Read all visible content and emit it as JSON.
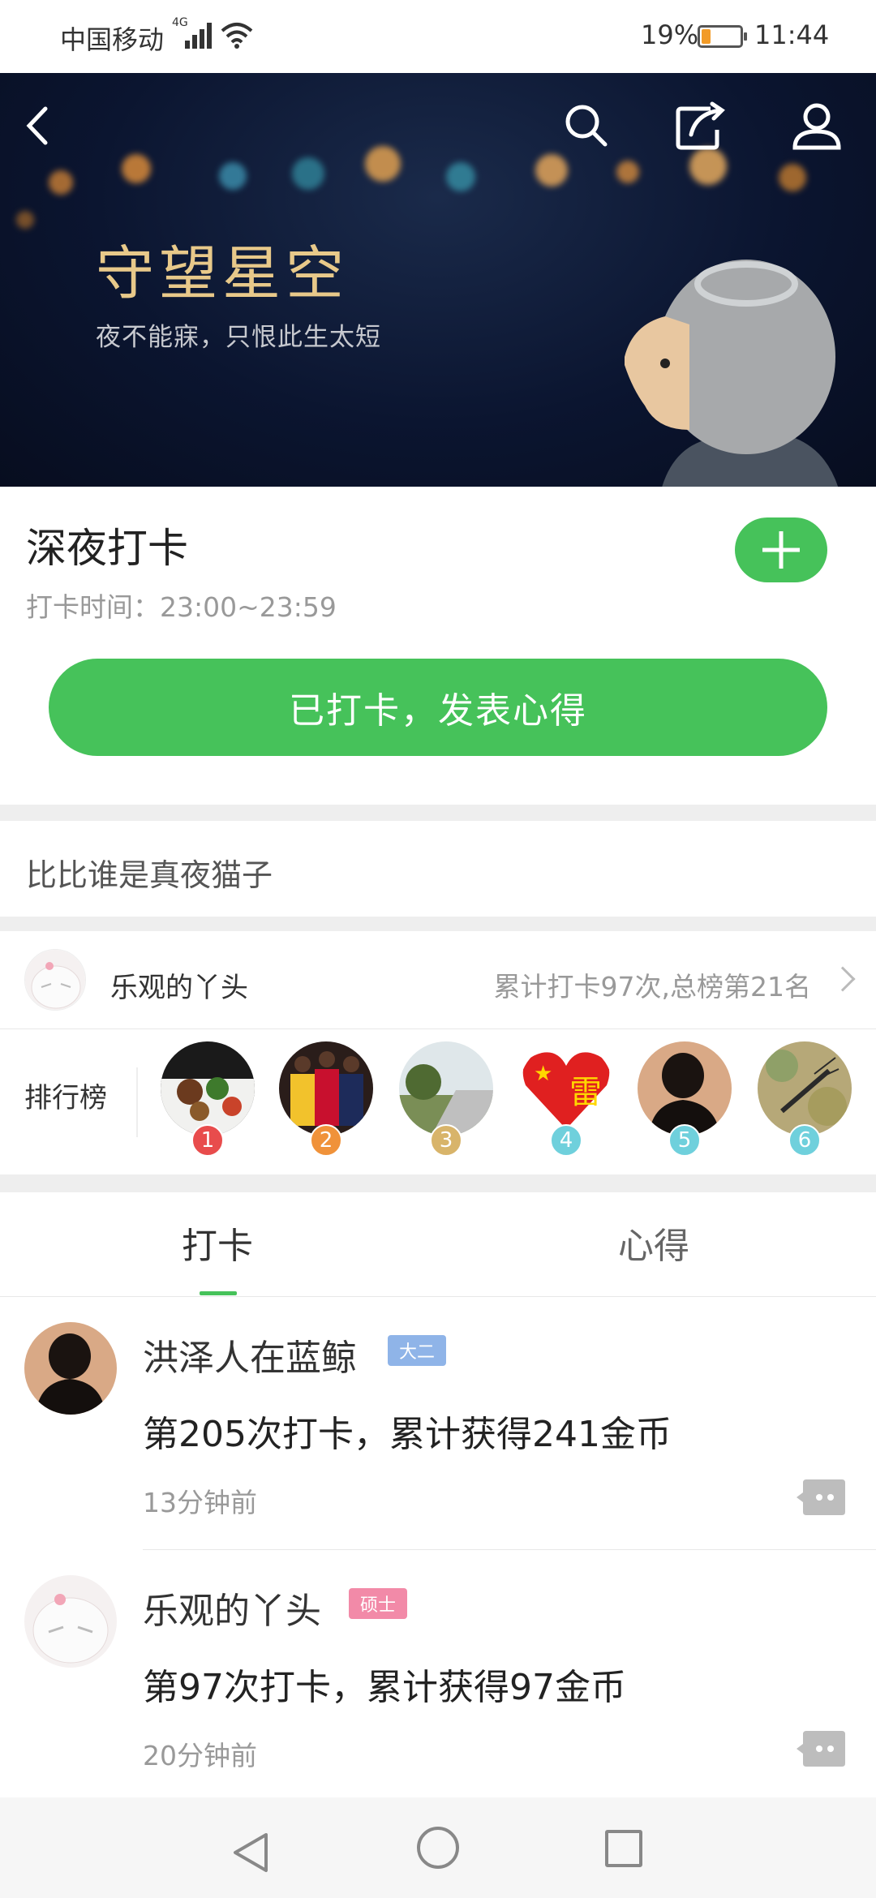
{
  "status_bar": {
    "carrier": "中国移动",
    "network": "4G",
    "battery_percent": "19%",
    "time": "11:44"
  },
  "banner": {
    "title": "守望星空",
    "subtitle": "夜不能寐，只恨此生太短",
    "icons": [
      "back-icon",
      "search-icon",
      "share-icon",
      "user-icon"
    ]
  },
  "checkin": {
    "title": "深夜打卡",
    "time_label": "打卡时间：23:00~23:59",
    "main_button": "已打卡，发表心得"
  },
  "slogan": "比比谁是真夜猫子",
  "me": {
    "name": "乐观的丫头",
    "stats": "累计打卡97次,总榜第21名"
  },
  "ranking": {
    "label": "排行榜",
    "items": [
      {
        "rank": "1",
        "badge_color": "#e84c4c"
      },
      {
        "rank": "2",
        "badge_color": "#f0923a"
      },
      {
        "rank": "3",
        "badge_color": "#d8b46a"
      },
      {
        "rank": "4",
        "badge_color": "#6fd0dc"
      },
      {
        "rank": "5",
        "badge_color": "#6fd0dc"
      },
      {
        "rank": "6",
        "badge_color": "#6fd0dc"
      }
    ]
  },
  "tabs": {
    "checkin": "打卡",
    "notes": "心得"
  },
  "feed": [
    {
      "name": "洪泽人在蓝鲸",
      "tag": "大二",
      "tag_color": "#8fb4e8",
      "text": "第205次打卡，累计获得241金币",
      "time": "13分钟前"
    },
    {
      "name": "乐观的丫头",
      "tag": "硕士",
      "tag_color": "#f28aa8",
      "text": "第97次打卡，累计获得97金币",
      "time": "20分钟前"
    }
  ],
  "colors": {
    "accent": "#46c25a"
  }
}
